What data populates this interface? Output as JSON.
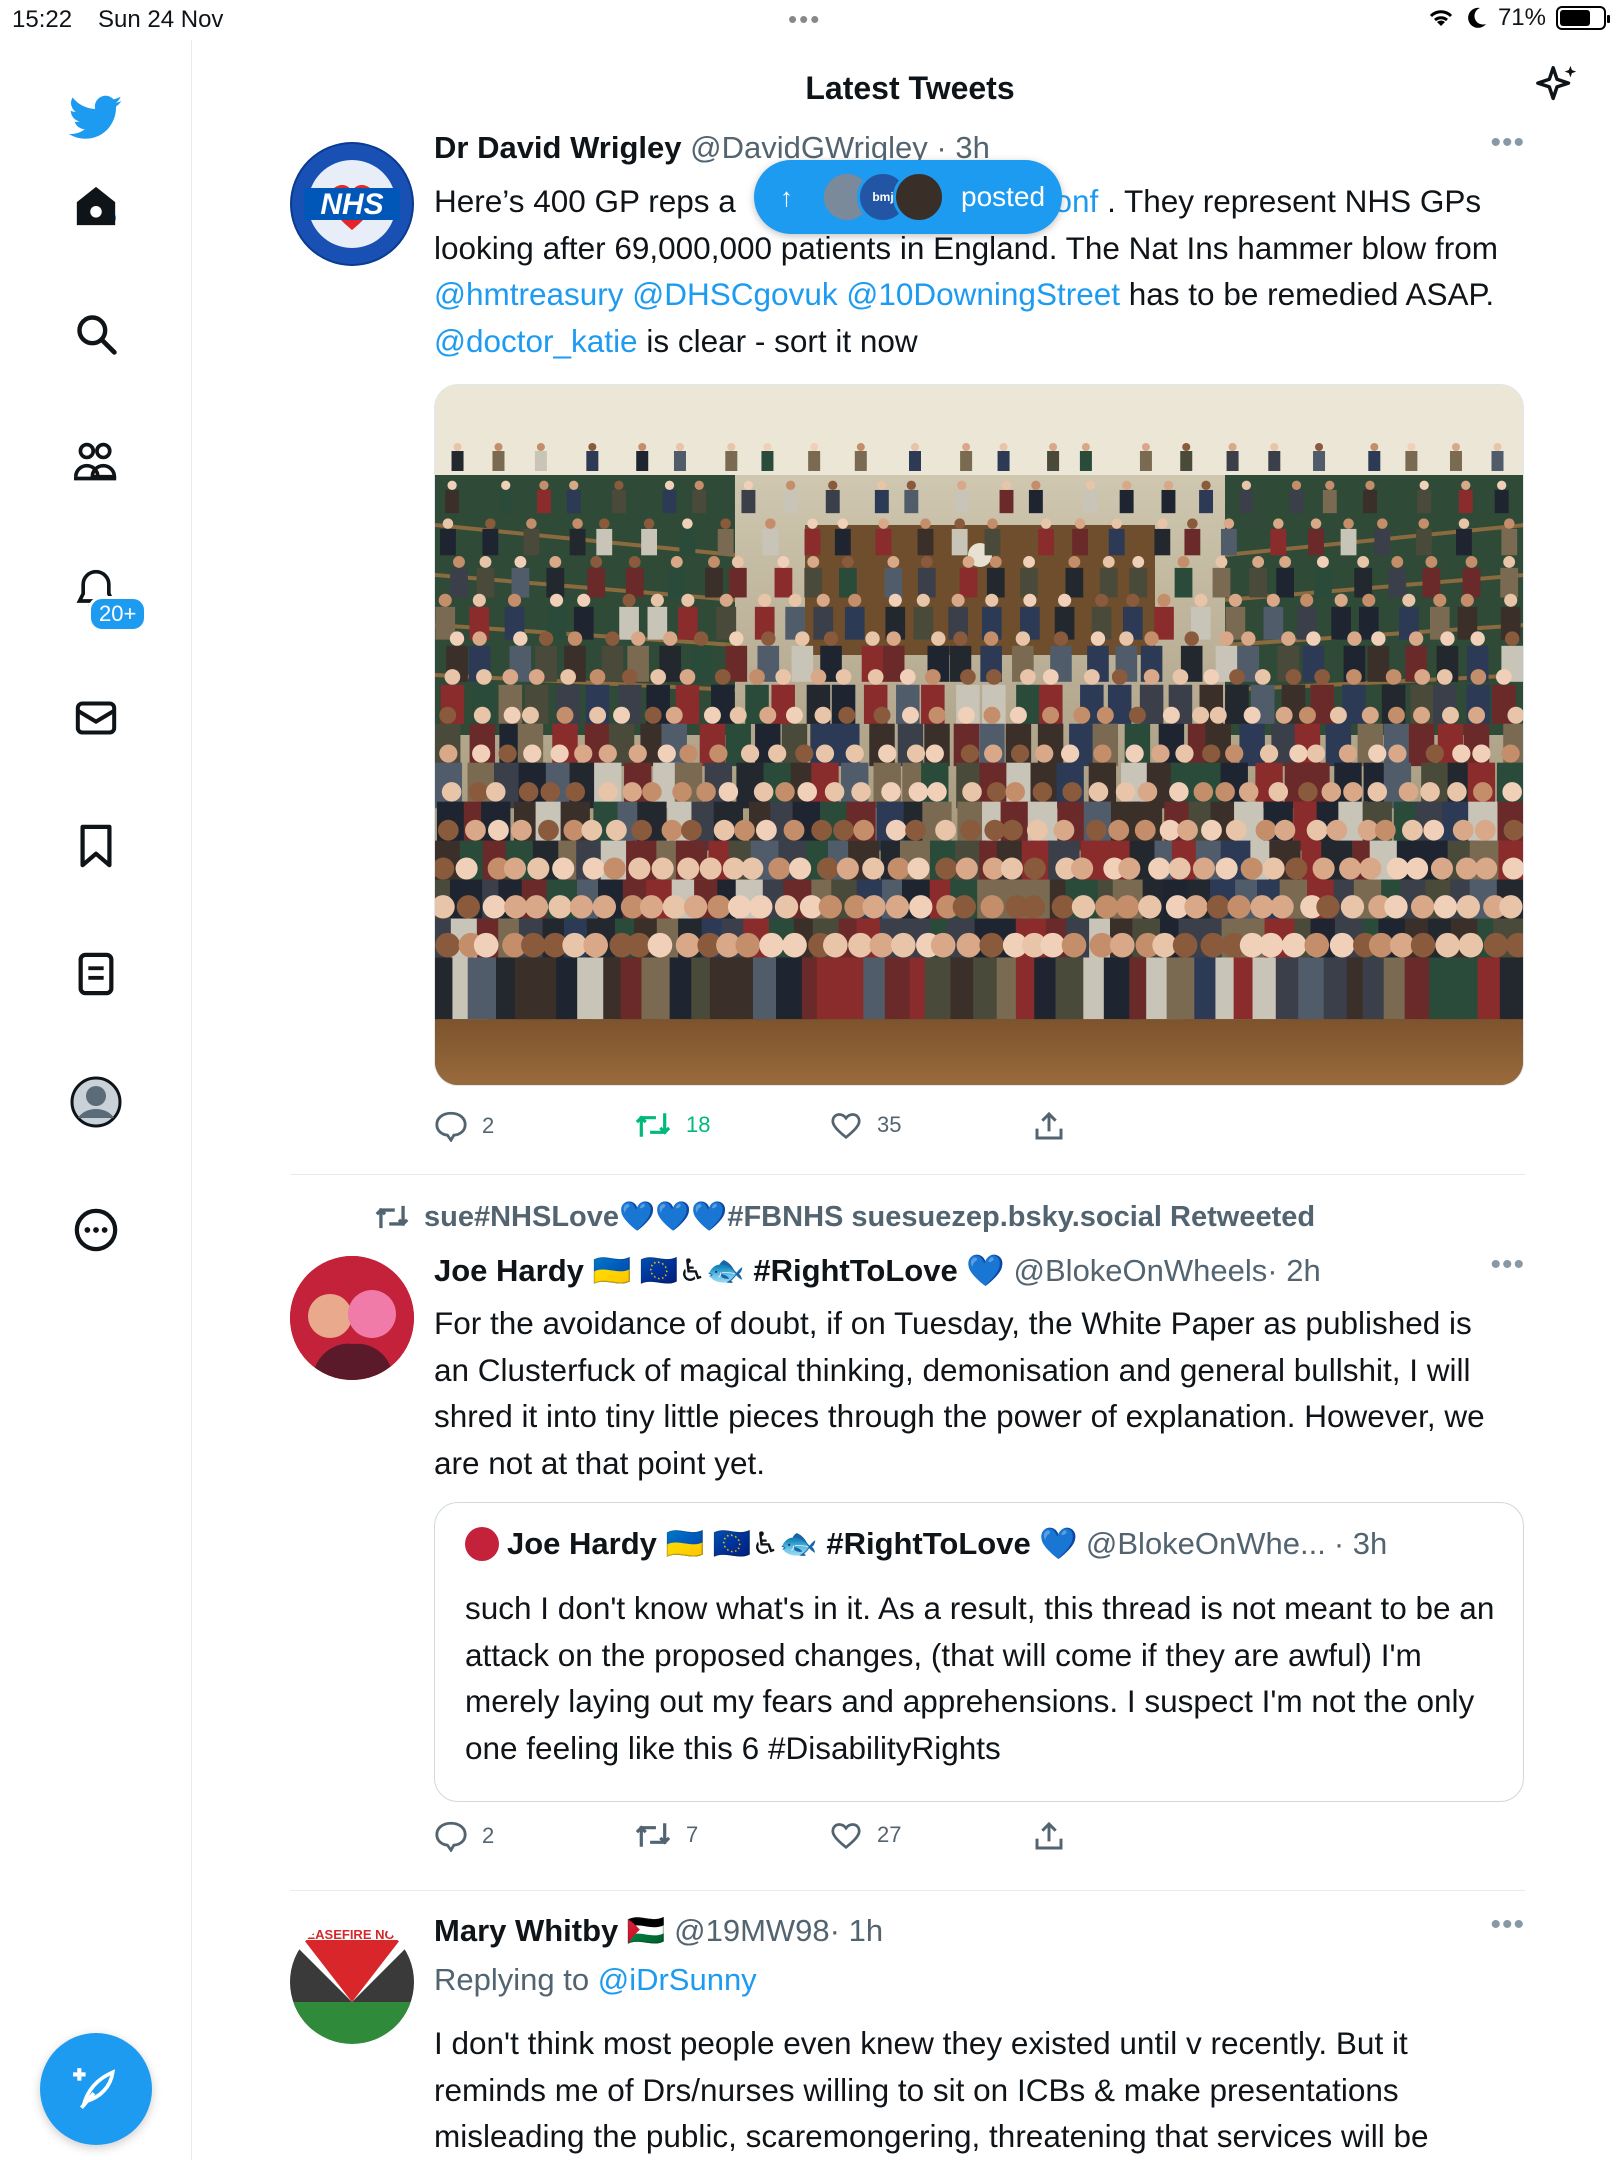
{
  "status_bar": {
    "time": "15:22",
    "date": "Sun 24 Nov",
    "battery": "71%",
    "battery_level": 0.71
  },
  "header": {
    "title": "Latest Tweets"
  },
  "sidebar": {
    "notifications_badge": "20+",
    "items": [
      "twitter-logo",
      "home",
      "search",
      "communities",
      "notifications",
      "messages",
      "bookmarks",
      "lists",
      "profile",
      "more"
    ]
  },
  "posted_pill": {
    "label": "posted",
    "avatar_text": "bmj"
  },
  "tweets": [
    {
      "author": "Dr David Wrigley",
      "handle": "@DavidGWrigley",
      "time": "· 3h",
      "avatar_text": "NHS",
      "text_before": "Here’s 400 GP reps a",
      "link0": "Conf",
      "text_1": " . They represent NHS GPs looking after 69,000,000 patients in England. The Nat Ins hammer blow from ",
      "link1": "@hmtreasury",
      "link2": "@DHSCgovuk",
      "link3": "@10DowningStreet",
      "text_2": " has to be remedied ASAP. ",
      "link4": "@doctor_katie",
      "text_3": " is clear - sort it now",
      "replies": "2",
      "retweets": "18",
      "likes": "35"
    },
    {
      "retweeted_by": "sue#NHSLove💙💙💙#FBNHS suesuezep.bsky.social Retweeted",
      "author": "Joe Hardy 🇺🇦 🇪🇺♿🐟 #RightToLove 💙",
      "handle": "@BlokeOnWheels",
      "time": "· 2h",
      "text": "For the avoidance of doubt, if on Tuesday, the White Paper as published is an Clusterfuck of magical thinking, demonisation and general bullshit, I will shred it into tiny little pieces through the power of explanation. However, we are not at that point yet.",
      "quote": {
        "author": "Joe Hardy 🇺🇦 🇪🇺♿🐟 #RightToLove 💙",
        "handle": "@BlokeOnWhe...",
        "time": "· 3h",
        "text": "such I don't know what's in it. As a result, this thread is not meant to be an attack on the proposed changes, (that will come if they are awful) I'm merely laying out my fears and apprehensions. I suspect I'm not the only one feeling like this 6 #DisabilityRights"
      },
      "replies": "2",
      "retweets": "7",
      "likes": "27"
    },
    {
      "author": "Mary Whitby 🇵🇸",
      "handle": "@19MW98",
      "time": "· 1h",
      "avatar_text": "CEASEFIRE NOW",
      "replying_prefix": "Replying to ",
      "replying_to": "@iDrSunny",
      "text": "I don't think most people even knew they existed until v recently. But it reminds me of Drs/nurses willing to sit on ICBs & make presentations misleading the public, scaremongering, threatening that services will be"
    }
  ],
  "colors": {
    "accent": "#1d9bf0",
    "retweet_green": "#00ba7c",
    "muted": "#536471"
  }
}
